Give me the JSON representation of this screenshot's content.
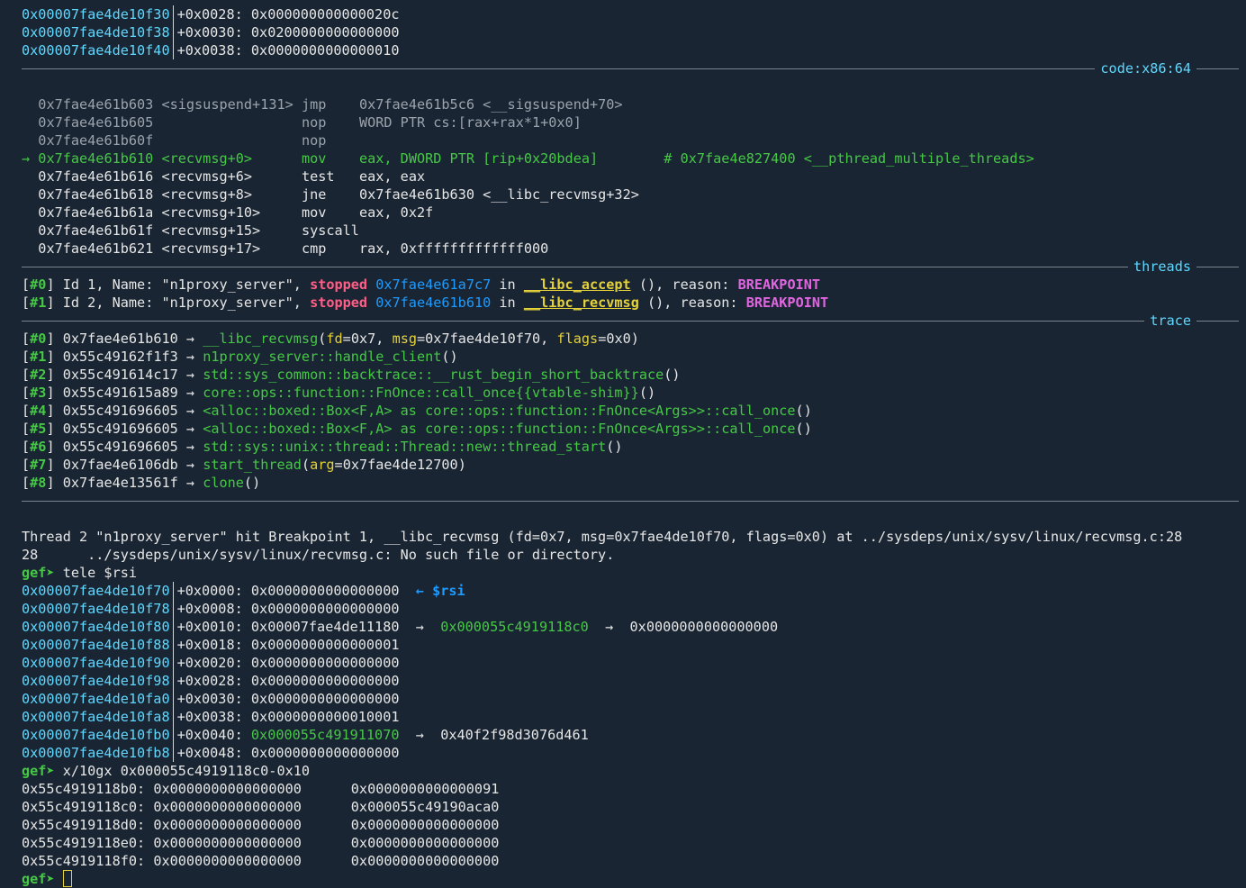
{
  "telescope_top": [
    {
      "addr": "0x00007fae4de10f30",
      "off": "+0x0028:",
      "val": "0x000000000000020c"
    },
    {
      "addr": "0x00007fae4de10f38",
      "off": "+0x0030:",
      "val": "0x0200000000000000"
    },
    {
      "addr": "0x00007fae4de10f40",
      "off": "+0x0038:",
      "val": "0x0000000000000010"
    }
  ],
  "section_code": "code:x86:64",
  "code": [
    {
      "marker": "  ",
      "addr": "0x7fae4e61b603",
      "sym": "<sigsuspend+131>",
      "mn": "jmp   ",
      "ops": "0x7fae4e61b5c6 <__sigsuspend+70>",
      "cmt": "",
      "cur": false
    },
    {
      "marker": "  ",
      "addr": "0x7fae4e61b605",
      "sym": "                ",
      "mn": "nop   ",
      "ops": "WORD PTR cs:[rax+rax*1+0x0]",
      "cmt": "",
      "cur": false
    },
    {
      "marker": "  ",
      "addr": "0x7fae4e61b60f",
      "sym": "                ",
      "mn": "nop   ",
      "ops": "",
      "cmt": "",
      "cur": false
    },
    {
      "marker": "→ ",
      "addr": "0x7fae4e61b610",
      "sym": "<recvmsg+0>     ",
      "mn": "mov   ",
      "ops": "eax, DWORD PTR [rip+0x20bdea]        ",
      "cmt": "# 0x7fae4e827400 <__pthread_multiple_threads>",
      "cur": true
    },
    {
      "marker": "  ",
      "addr": "0x7fae4e61b616",
      "sym": "<recvmsg+6>     ",
      "mn": "test  ",
      "ops": "eax, eax",
      "cmt": "",
      "cur": false
    },
    {
      "marker": "  ",
      "addr": "0x7fae4e61b618",
      "sym": "<recvmsg+8>     ",
      "mn": "jne   ",
      "ops": "0x7fae4e61b630 <__libc_recvmsg+32>",
      "cmt": "",
      "cur": false
    },
    {
      "marker": "  ",
      "addr": "0x7fae4e61b61a",
      "sym": "<recvmsg+10>    ",
      "mn": "mov   ",
      "ops": "eax, 0x2f",
      "cmt": "",
      "cur": false
    },
    {
      "marker": "  ",
      "addr": "0x7fae4e61b61f",
      "sym": "<recvmsg+15>    ",
      "mn": "syscall",
      "ops": "",
      "cmt": "",
      "cur": false
    },
    {
      "marker": "  ",
      "addr": "0x7fae4e61b621",
      "sym": "<recvmsg+17>    ",
      "mn": "cmp   ",
      "ops": "rax, 0xfffffffffffff000",
      "cmt": "",
      "cur": false
    }
  ],
  "section_threads": "threads",
  "threads": [
    {
      "idx": "#0",
      "pre": " Id 1, Name: \"n1proxy_server\", ",
      "state": "stopped",
      "addr": "0x7fae4e61a7c7",
      "in": " in ",
      "fn": "__libc_accept",
      "post": " (), reason: ",
      "reason": "BREAKPOINT"
    },
    {
      "idx": "#1",
      "pre": " Id 2, Name: \"n1proxy_server\", ",
      "state": "stopped",
      "addr": "0x7fae4e61b610",
      "in": " in ",
      "fn": "__libc_recvmsg",
      "post": " (), reason: ",
      "reason": "BREAKPOINT"
    }
  ],
  "section_trace": "trace",
  "trace": [
    {
      "idx": "#0",
      "addr": "0x7fae4e61b610",
      "fn": "__libc_recvmsg",
      "args": [
        [
          "fd",
          "0x7"
        ],
        [
          "msg",
          "0x7fae4de10f70"
        ],
        [
          "flags",
          "0x0"
        ]
      ]
    },
    {
      "idx": "#1",
      "addr": "0x55c49162f1f3",
      "fn": "n1proxy_server::handle_client",
      "args": []
    },
    {
      "idx": "#2",
      "addr": "0x55c491614c17",
      "fn": "std::sys_common::backtrace::__rust_begin_short_backtrace",
      "args": []
    },
    {
      "idx": "#3",
      "addr": "0x55c491615a89",
      "fn": "core::ops::function::FnOnce::call_once{{vtable-shim}}",
      "args": []
    },
    {
      "idx": "#4",
      "addr": "0x55c491696605",
      "fn": "<alloc::boxed::Box<F,A> as core::ops::function::FnOnce<Args>>::call_once",
      "args": []
    },
    {
      "idx": "#5",
      "addr": "0x55c491696605",
      "fn": "<alloc::boxed::Box<F,A> as core::ops::function::FnOnce<Args>>::call_once",
      "args": []
    },
    {
      "idx": "#6",
      "addr": "0x55c491696605",
      "fn": "std::sys::unix::thread::Thread::new::thread_start",
      "args": []
    },
    {
      "idx": "#7",
      "addr": "0x7fae4e6106db",
      "fn": "start_thread",
      "args": [
        [
          "arg",
          "0x7fae4de12700"
        ]
      ]
    },
    {
      "idx": "#8",
      "addr": "0x7fae4e13561f",
      "fn": "clone",
      "args": []
    }
  ],
  "msg1": "Thread 2 \"n1proxy_server\" hit Breakpoint 1, __libc_recvmsg (fd=0x7, msg=0x7fae4de10f70, flags=0x0) at ../sysdeps/unix/sysv/linux/recvmsg.c:28",
  "msg2": "28      ../sysdeps/unix/sysv/linux/recvmsg.c: No such file or directory.",
  "prompt": "gef➤ ",
  "cmd1": "tele $rsi",
  "telescope": [
    {
      "addr": "0x00007fae4de10f70",
      "off": "+0x0000:",
      "val": "0x0000000000000000",
      "extra": "  ← $rsi"
    },
    {
      "addr": "0x00007fae4de10f78",
      "off": "+0x0008:",
      "val": "0x0000000000000000",
      "extra": ""
    },
    {
      "addr": "0x00007fae4de10f80",
      "off": "+0x0010:",
      "val": "0x00007fae4de11180",
      "extra": ""
    },
    {
      "addr": "0x00007fae4de10f88",
      "off": "+0x0018:",
      "val": "0x0000000000000001",
      "extra": ""
    },
    {
      "addr": "0x00007fae4de10f90",
      "off": "+0x0020:",
      "val": "0x0000000000000000",
      "extra": ""
    },
    {
      "addr": "0x00007fae4de10f98",
      "off": "+0x0028:",
      "val": "0x0000000000000000",
      "extra": ""
    },
    {
      "addr": "0x00007fae4de10fa0",
      "off": "+0x0030:",
      "val": "0x0000000000000000",
      "extra": ""
    },
    {
      "addr": "0x00007fae4de10fa8",
      "off": "+0x0038:",
      "val": "0x0000000000010001",
      "extra": ""
    },
    {
      "addr": "0x00007fae4de10fb0",
      "off": "+0x0040:",
      "val": "0x000055c491911070",
      "extra": ""
    },
    {
      "addr": "0x00007fae4de10fb8",
      "off": "+0x0048:",
      "val": "0x0000000000000000",
      "extra": ""
    }
  ],
  "tele_chain_a": "  →  ",
  "tele_chain_a_val": "0x000055c4919118c0",
  "tele_chain_a_tail": "  →  0x0000000000000000",
  "tele_chain_b": "  →  0x40f2f98d3076d461",
  "cmd2": "x/10gx 0x000055c4919118c0-0x10",
  "hexdump": [
    {
      "addr": "0x55c4919118b0:",
      "a": "0x0000000000000000",
      "b": "0x0000000000000091"
    },
    {
      "addr": "0x55c4919118c0:",
      "a": "0x0000000000000000",
      "b": "0x000055c49190aca0"
    },
    {
      "addr": "0x55c4919118d0:",
      "a": "0x0000000000000000",
      "b": "0x0000000000000000"
    },
    {
      "addr": "0x55c4919118e0:",
      "a": "0x0000000000000000",
      "b": "0x0000000000000000"
    },
    {
      "addr": "0x55c4919118f0:",
      "a": "0x0000000000000000",
      "b": "0x0000000000000000"
    }
  ]
}
